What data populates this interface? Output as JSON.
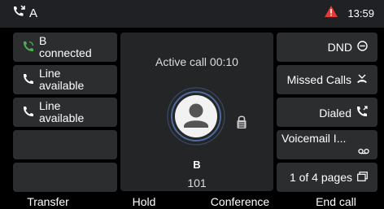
{
  "status_bar": {
    "account": "A",
    "time": "13:59",
    "icons": [
      "call-account-icon",
      "warning-icon"
    ]
  },
  "lines": [
    {
      "name": "B",
      "state": "connected",
      "icon": "phone-active-icon",
      "color": "#4caf50"
    },
    {
      "name": "Line",
      "state": "available",
      "icon": "phone-icon",
      "color": "#ffffff"
    },
    {
      "name": "Line",
      "state": "available",
      "icon": "phone-icon",
      "color": "#ffffff"
    }
  ],
  "call": {
    "status": "Active call 00:10",
    "contact_name": "B",
    "contact_number": "101",
    "icons": [
      "avatar-icon",
      "secure-lock-icon"
    ]
  },
  "right_buttons": [
    {
      "label": "DND",
      "icon": "dnd-icon"
    },
    {
      "label": "Missed Calls",
      "icon": "missed-calls-icon"
    },
    {
      "label": "Dialed",
      "icon": "dialed-icon"
    },
    {
      "label": "Voicemail I...",
      "icon": "voicemail-icon"
    },
    {
      "label": "1 of 4 pages",
      "icon": "pages-icon"
    }
  ],
  "softkeys": [
    "Transfer",
    "Hold",
    "Conference",
    "End call"
  ],
  "colors": {
    "accent_green": "#4caf50",
    "warning_red": "#e53935",
    "panel": "#2c2d2f"
  }
}
